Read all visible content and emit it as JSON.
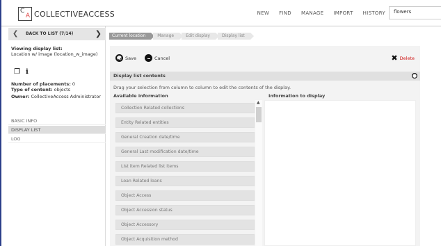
{
  "header": {
    "logo_text": "COLLECTIVEACCESS",
    "nav": [
      "NEW",
      "FIND",
      "MANAGE",
      "IMPORT",
      "HISTORY"
    ],
    "search_value": "flowers"
  },
  "sidebar": {
    "back_label": "BACK TO LIST (7/14)",
    "viewing_label": "Viewing display list:",
    "viewing_value": "Location w/ image (location_w_image)",
    "placements_label": "Number of placements:",
    "placements_value": "0",
    "content_label": "Type of content:",
    "content_value": "objects",
    "owner_label": "Owner:",
    "owner_value": "CollectiveAccess Administrator",
    "nav": [
      "BASIC INFO",
      "DISPLAY LIST",
      "LOG"
    ],
    "active_nav": "DISPLAY LIST"
  },
  "breadcrumb": [
    "Current location",
    "Manage",
    "Edit display",
    "Display list"
  ],
  "actions": {
    "save_label": "Save",
    "cancel_label": "Cancel",
    "delete_label": "Delete"
  },
  "section": {
    "title": "Display list contents",
    "instruction": "Drag your selection from column to column to edit the contents of the display.",
    "available_header": "Available information",
    "display_header": "Information to display",
    "available_items": [
      "Collection Related collections",
      "Entity Related entities",
      "General Creation date/time",
      "General Last modification date/time",
      "List item Related list items",
      "Loan Related loans",
      "Object Access",
      "Object Accession status",
      "Object Accessory",
      "Object Acquisition method"
    ]
  },
  "colors": {
    "frame_accent": "#2d3f8a",
    "delete_red": "#d01818",
    "logo_red": "#e04848"
  }
}
